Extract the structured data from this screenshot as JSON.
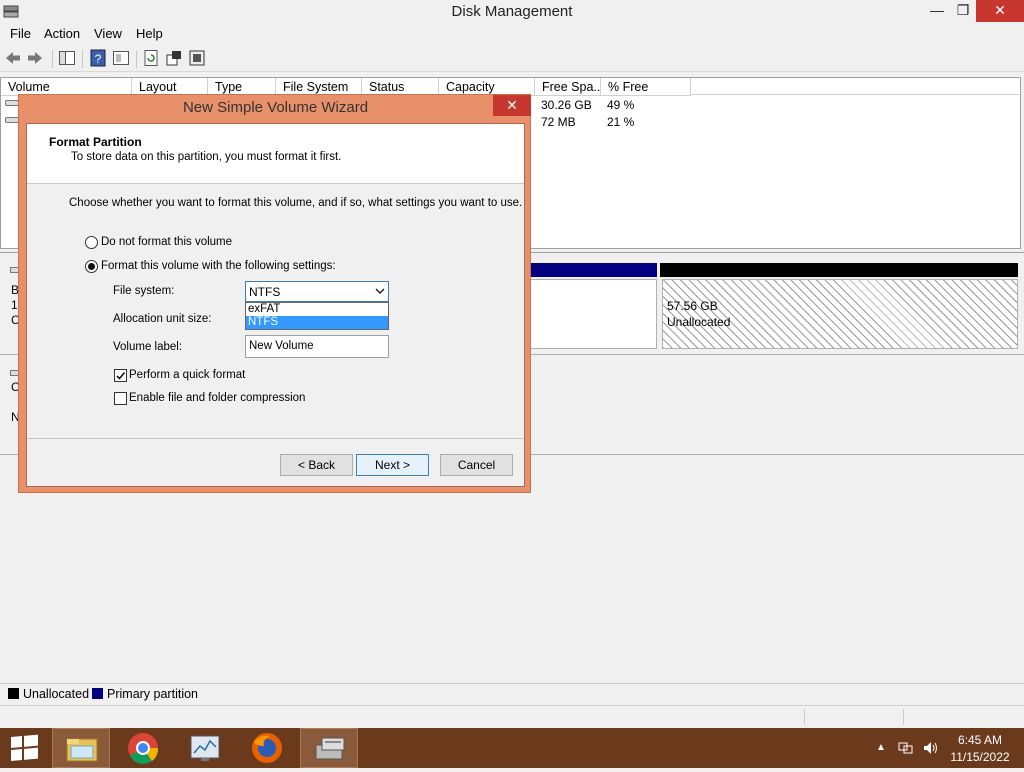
{
  "window": {
    "title": "Disk Management",
    "minimize": "—",
    "restore": "❐",
    "close": "✕"
  },
  "menu": [
    "File",
    "Action",
    "View",
    "Help"
  ],
  "toolbar_icons": [
    "back-icon",
    "forward-icon",
    "console-tree-icon",
    "help-icon",
    "properties-icon",
    "refresh-icon",
    "rescan-icon",
    "settings-icon"
  ],
  "volume_table": {
    "columns": [
      "Volume",
      "Layout",
      "Type",
      "File System",
      "Status",
      "Capacity",
      "Free Spa...",
      "% Free"
    ],
    "rows": [
      {
        "free_space": "30.26 GB",
        "pct_free": "49 %"
      },
      {
        "free_space": "72 MB",
        "pct_free": "21 %"
      }
    ]
  },
  "disk0": {
    "label_fragments": [
      "B",
      "1",
      "C"
    ],
    "bar_colors": [
      "#000080",
      "#000000"
    ],
    "unallocated_size": "57.56 GB",
    "unallocated_label": "Unallocated"
  },
  "disk1": {
    "label_fragments": [
      "C",
      "N"
    ]
  },
  "legend": {
    "items": [
      {
        "label": "Unallocated",
        "color": "#000000"
      },
      {
        "label": "Primary partition",
        "color": "#000080"
      }
    ]
  },
  "dialog": {
    "title": "New Simple Volume Wizard",
    "close": "✕",
    "header_title": "Format Partition",
    "header_subtitle": "To store data on this partition, you must format it first.",
    "instruction": "Choose whether you want to format this volume, and if so, what settings you want to use.",
    "radio_no_format": "Do not format this volume",
    "radio_format": "Format this volume with the following settings:",
    "radio_selected": "format",
    "file_system_label": "File system:",
    "file_system_value": "NTFS",
    "file_system_options": [
      "exFAT",
      "NTFS"
    ],
    "file_system_highlighted": "NTFS",
    "allocation_label": "Allocation unit size:",
    "volume_label_label": "Volume label:",
    "volume_label_value": "New Volume",
    "quick_format_label": "Perform a quick format",
    "quick_format_checked": true,
    "compression_label": "Enable file and folder compression",
    "compression_checked": false,
    "back_button": "< Back",
    "next_button": "Next >",
    "cancel_button": "Cancel"
  },
  "taskbar": {
    "apps": [
      "windows-start-icon",
      "file-explorer-icon",
      "chrome-icon",
      "performance-monitor-icon",
      "firefox-icon",
      "disk-management-icon"
    ],
    "time": "6:45 AM",
    "date": "11/15/2022"
  }
}
